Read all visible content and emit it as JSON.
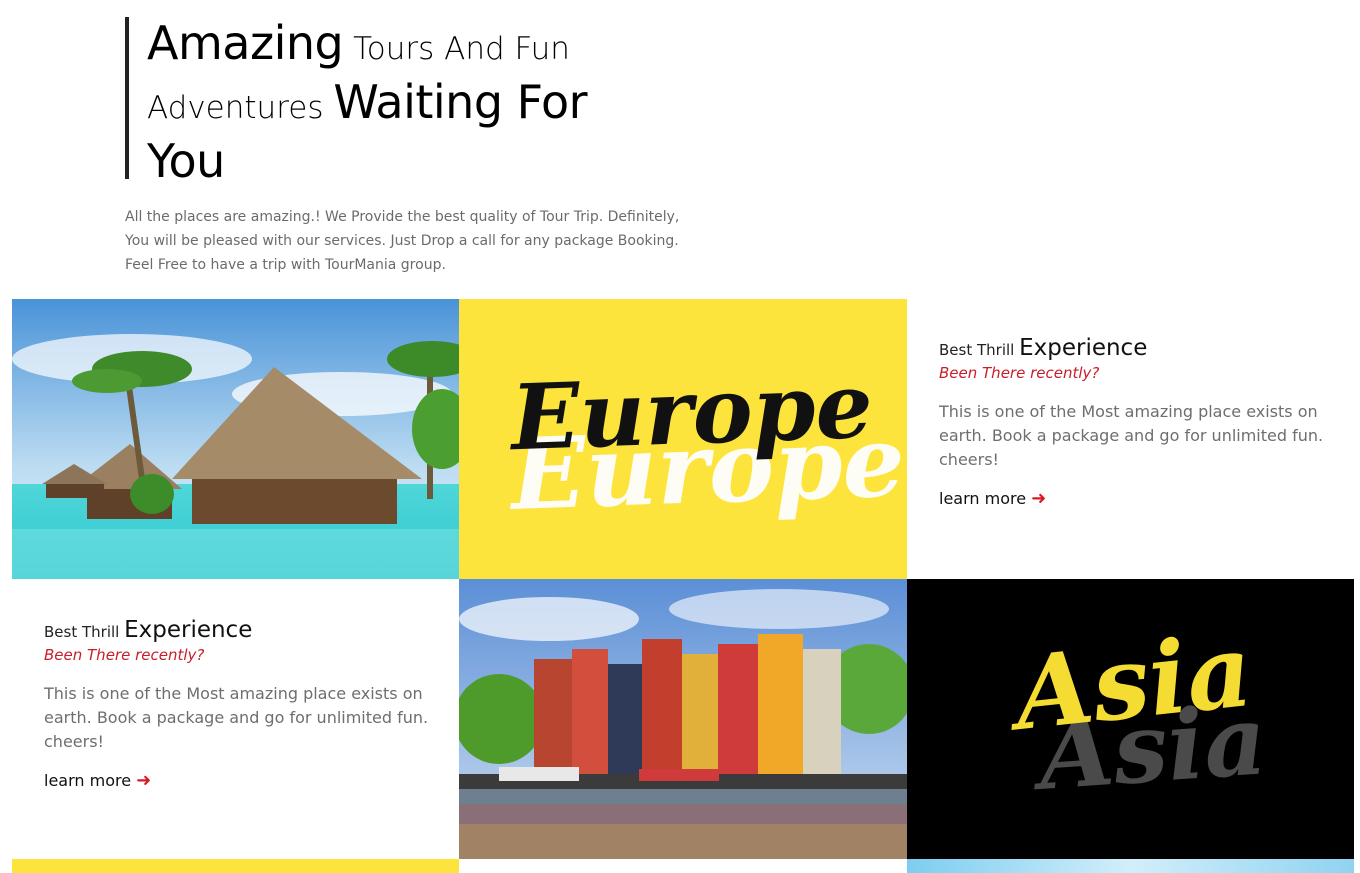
{
  "hero": {
    "title_a": "Amazing",
    "title_b": " Tours And Fun",
    "title_c": "Adventures ",
    "title_d": "Waiting For",
    "title_e": "You",
    "description": "All the places are amazing.! We Provide the best quality of Tour Trip. Definitely, You will be pleased with our services. Just Drop a call for any package Booking. Feel Free to have a trip with TourMania group."
  },
  "europe_card": {
    "word": "Europe",
    "bg_color": "#fde43d"
  },
  "asia_card": {
    "word": "Asia",
    "bg_color": "#000000",
    "text_color": "#f5dc33"
  },
  "cards": [
    {
      "eyebrow": "Best Thrill ",
      "heading": "Experience",
      "subheading": "Been There recently?",
      "text": "This is one of the Most amazing place exists on earth. Book a package and go for unlimited fun. cheers!",
      "link": "learn more"
    },
    {
      "eyebrow": "Best Thrill ",
      "heading": "Experience",
      "subheading": "Been There recently?",
      "text": "This is one of the Most amazing place exists on earth. Book a package and go for unlimited fun. cheers!",
      "link": "learn more"
    }
  ],
  "colors": {
    "accent_red": "#c81e2a",
    "yellow": "#fde43d"
  },
  "icons": {
    "arrow": "arrow-right-icon"
  }
}
